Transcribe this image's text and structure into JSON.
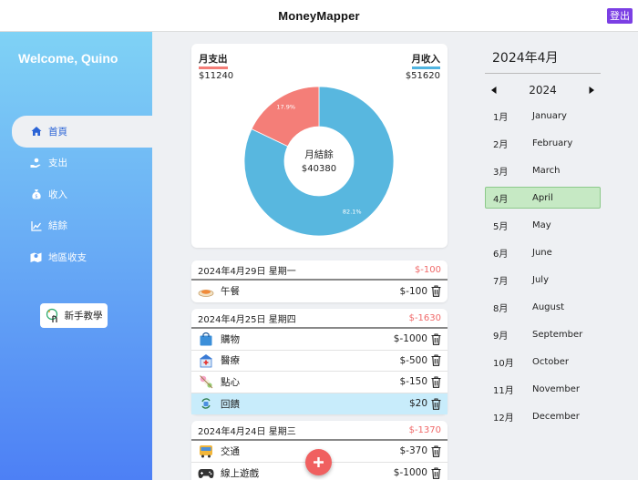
{
  "header": {
    "title": "MoneyMapper",
    "logout_label": "登出"
  },
  "sidebar": {
    "welcome": "Welcome, Quino",
    "items": [
      {
        "label": "首頁",
        "icon": "home-icon"
      },
      {
        "label": "支出",
        "icon": "expense-hand-icon"
      },
      {
        "label": "收入",
        "icon": "money-bag-icon"
      },
      {
        "label": "結餘",
        "icon": "chart-line-icon"
      },
      {
        "label": "地區收支",
        "icon": "map-icon"
      }
    ],
    "tutorial_label": "新手教學"
  },
  "summary": {
    "expense_label": "月支出",
    "expense_value": "$11240",
    "income_label": "月收入",
    "income_value": "$51620",
    "center_label": "月結餘",
    "center_value": "$40380"
  },
  "chart_data": {
    "type": "pie",
    "title": "",
    "labels": [
      "月支出",
      "月收入"
    ],
    "values": [
      17.9,
      82.1
    ],
    "value_labels": [
      "17.9%",
      "82.1%"
    ],
    "colors": [
      "#f47e78",
      "#58b7df"
    ],
    "donut": true
  },
  "days": [
    {
      "date": "2024年4月29日 星期一",
      "total": "$-100",
      "items": [
        {
          "name": "午餐",
          "amount": "$-100",
          "icon": "meal-icon"
        }
      ]
    },
    {
      "date": "2024年4月25日 星期四",
      "total": "$-1630",
      "items": [
        {
          "name": "購物",
          "amount": "$-1000",
          "icon": "shopping-bag-icon"
        },
        {
          "name": "醫療",
          "amount": "$-500",
          "icon": "hospital-icon"
        },
        {
          "name": "點心",
          "amount": "$-150",
          "icon": "snack-icon"
        },
        {
          "name": "回饋",
          "amount": "$20",
          "icon": "refund-icon",
          "highlight": true
        }
      ]
    },
    {
      "date": "2024年4月24日 星期三",
      "total": "$-1370",
      "items": [
        {
          "name": "交通",
          "amount": "$-370",
          "icon": "bus-icon"
        },
        {
          "name": "線上遊戲",
          "amount": "$-1000",
          "icon": "gamepad-icon"
        }
      ]
    }
  ],
  "colors": {
    "accent": "#2a63d6",
    "expense": "#f06a6a",
    "income": "#58b7df",
    "active_month": "#c6e9c4",
    "logout": "#7b3fe4"
  },
  "calendar": {
    "current_month": "2024年4月",
    "year": "2024",
    "months": [
      {
        "num": "1月",
        "name": "January"
      },
      {
        "num": "2月",
        "name": "February"
      },
      {
        "num": "3月",
        "name": "March"
      },
      {
        "num": "4月",
        "name": "April",
        "active": true
      },
      {
        "num": "5月",
        "name": "May"
      },
      {
        "num": "6月",
        "name": "June"
      },
      {
        "num": "7月",
        "name": "July"
      },
      {
        "num": "8月",
        "name": "August"
      },
      {
        "num": "9月",
        "name": "September"
      },
      {
        "num": "10月",
        "name": "October"
      },
      {
        "num": "11月",
        "name": "November"
      },
      {
        "num": "12月",
        "name": "December"
      }
    ]
  }
}
